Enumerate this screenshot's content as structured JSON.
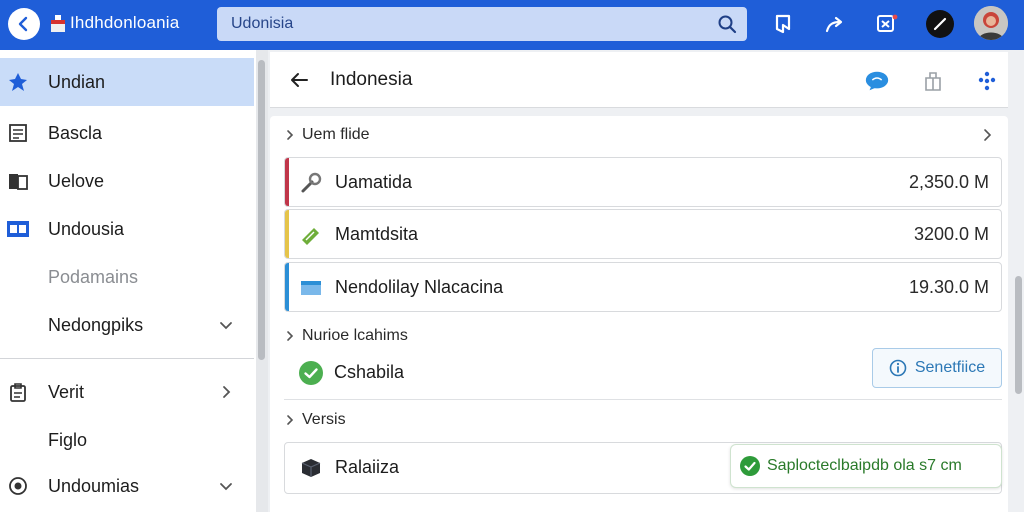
{
  "app": {
    "title": "Ihdhdonloania"
  },
  "search": {
    "value": "Udonisia"
  },
  "sidebar": {
    "items": [
      {
        "label": "Undian",
        "icon": "pin-icon",
        "active": true
      },
      {
        "label": "Bascla",
        "icon": "list-icon"
      },
      {
        "label": "Uelove",
        "icon": "folder-icon"
      },
      {
        "label": "Undousia",
        "icon": "window-icon"
      },
      {
        "label": "Podamains",
        "muted": true
      },
      {
        "label": "Nedongpiks",
        "chevron": "down"
      },
      {
        "label": "Verit",
        "icon": "clipboard-icon",
        "chevron": "right"
      },
      {
        "label": "Figlo"
      },
      {
        "label": "Undoumias",
        "icon": "radio-icon",
        "chevron": "down"
      }
    ]
  },
  "header": {
    "title": "Indonesia"
  },
  "main": {
    "section1": {
      "label": "Uem flide"
    },
    "cards": [
      {
        "label": "Uamatida",
        "value": "2,350.0 M",
        "accent": "#c0364a"
      },
      {
        "label": "Mamtdsita",
        "value": "3200.0 M",
        "accent": "#e5c44a"
      },
      {
        "label": "Nendolilay Nlacacina",
        "value": "19.30.0 M",
        "accent": "#2c8fd6"
      }
    ],
    "section2": {
      "label": "Nurioe lcahims"
    },
    "status_row": {
      "label": "Cshabila",
      "button": "Senetfiice"
    },
    "section3": {
      "label": "Versis"
    },
    "bottom_row": {
      "label": "Ralaiiza",
      "toast": "Saplocteclbaipdb ola s7 cm"
    }
  },
  "colors": {
    "topbar": "#1f5ed8",
    "active_bg": "#c9dcf8",
    "success": "#2e9b3a"
  }
}
